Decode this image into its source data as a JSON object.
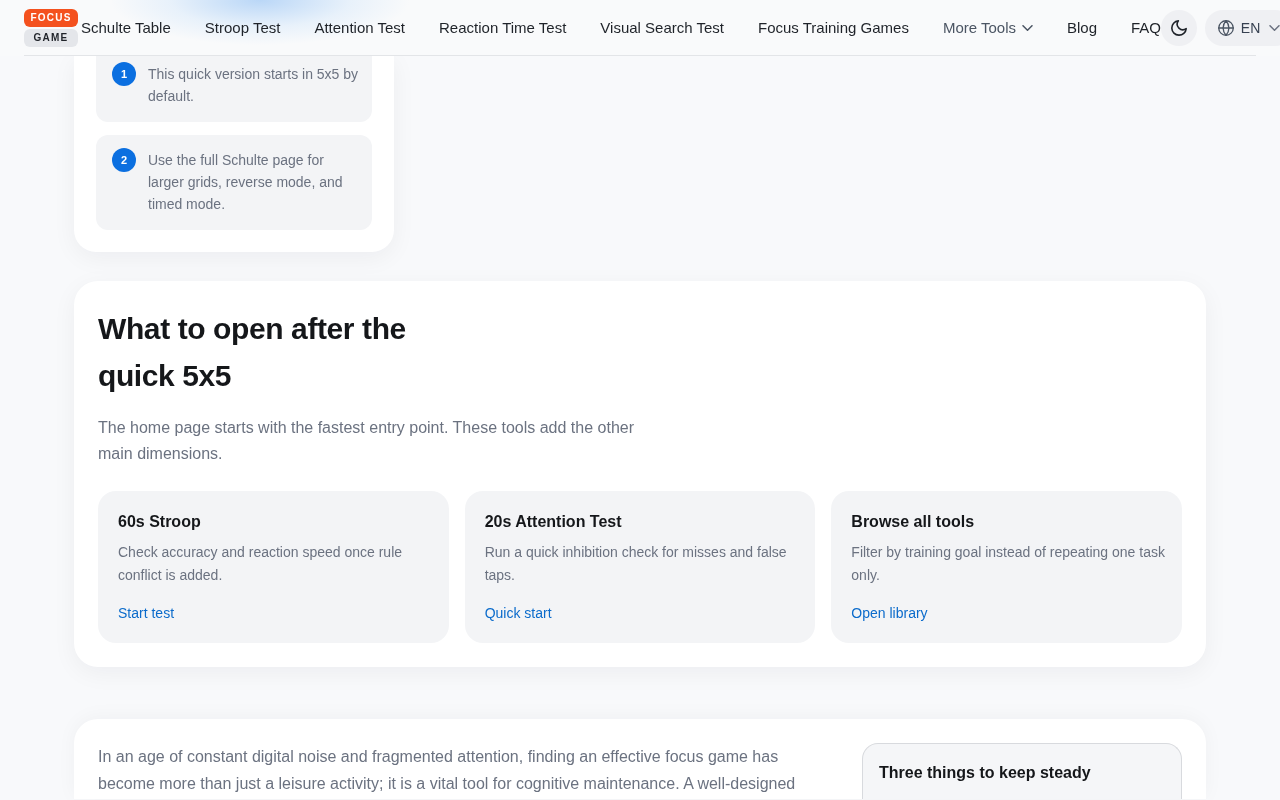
{
  "header": {
    "logo": {
      "top": "FOCUS",
      "bottom": "GAME"
    },
    "nav": [
      {
        "label": "Schulte Table",
        "kind": "link"
      },
      {
        "label": "Stroop Test",
        "kind": "link"
      },
      {
        "label": "Attention Test",
        "kind": "link"
      },
      {
        "label": "Reaction Time Test",
        "kind": "link"
      },
      {
        "label": "Visual Search Test",
        "kind": "link"
      },
      {
        "label": "Focus Training Games",
        "kind": "link"
      },
      {
        "label": "More Tools",
        "kind": "dropdown"
      },
      {
        "label": "Blog",
        "kind": "link"
      },
      {
        "label": "FAQ",
        "kind": "link"
      }
    ],
    "language": "EN"
  },
  "steps_panel": {
    "steps": [
      {
        "number": "1",
        "text": "This quick version starts in 5x5 by default."
      },
      {
        "number": "2",
        "text": "Use the full Schulte page for larger grids, reverse mode, and timed mode."
      }
    ]
  },
  "next_section": {
    "title": "What to open after the quick 5x5",
    "intro": "The home page starts with the fastest entry point. These tools add the other main dimensions.",
    "cards": [
      {
        "title": "60s Stroop",
        "description": "Check accuracy and reaction speed once rule conflict is added.",
        "link": "Start test"
      },
      {
        "title": "20s Attention Test",
        "description": "Run a quick inhibition check for misses and false taps.",
        "link": "Quick start"
      },
      {
        "title": "Browse all tools",
        "description": "Filter by training goal instead of repeating one task only.",
        "link": "Open library"
      }
    ]
  },
  "article": {
    "paragraph": "In an age of constant digital noise and fragmented attention, finding an effective focus game has become more than just a leisure activity; it is a vital tool for cognitive maintenance. A well-designed",
    "aside": {
      "title": "Three things to keep steady"
    }
  }
}
